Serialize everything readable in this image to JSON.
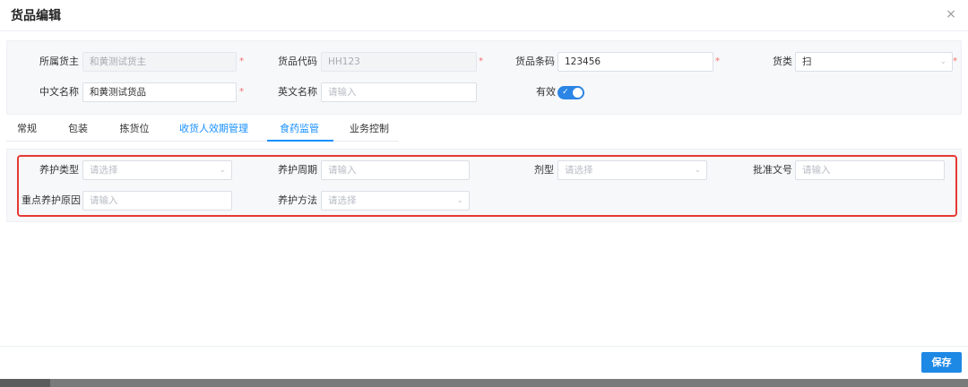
{
  "dialog": {
    "title": "货品编辑",
    "close_icon": "close-icon",
    "close_glyph": "×"
  },
  "form": {
    "owner": {
      "label": "所属货主",
      "value": "和黄测试货主",
      "required_mark": "*"
    },
    "goods_code": {
      "label": "货品代码",
      "value": "HH123",
      "required_mark": "*"
    },
    "barcode": {
      "label": "货品条码",
      "value": "123456",
      "required_mark": "*"
    },
    "category": {
      "label": "货类",
      "value": "扫",
      "required_mark": "*"
    },
    "cn_name": {
      "label": "中文名称",
      "value": "和黄测试货品",
      "required_mark": "*"
    },
    "en_name": {
      "label": "英文名称",
      "placeholder": "请输入"
    },
    "valid": {
      "label": "有效",
      "checked": true
    }
  },
  "tabs": [
    {
      "label": "常规"
    },
    {
      "label": "包装"
    },
    {
      "label": "拣货位"
    },
    {
      "label": "收货人效期管理"
    },
    {
      "label": "食药监管",
      "active": true
    },
    {
      "label": "业务控制"
    }
  ],
  "food_drug": {
    "maintenance_type": {
      "label": "养护类型",
      "placeholder": "请选择"
    },
    "maintenance_cycle": {
      "label": "养护周期",
      "placeholder": "请输入"
    },
    "dosage_form": {
      "label": "剂型",
      "placeholder": "请选择"
    },
    "approval_no": {
      "label": "批准文号",
      "placeholder": "请输入"
    },
    "key_reason": {
      "label": "重点养护原因",
      "placeholder": "请输入"
    },
    "maintenance_method": {
      "label": "养护方法",
      "placeholder": "请选择"
    }
  },
  "footer": {
    "save_label": "保存"
  },
  "colors": {
    "accent": "#1890ff",
    "save_button": "#1e88e5",
    "required": "#f56c6c",
    "highlight_box": "#e53935"
  }
}
